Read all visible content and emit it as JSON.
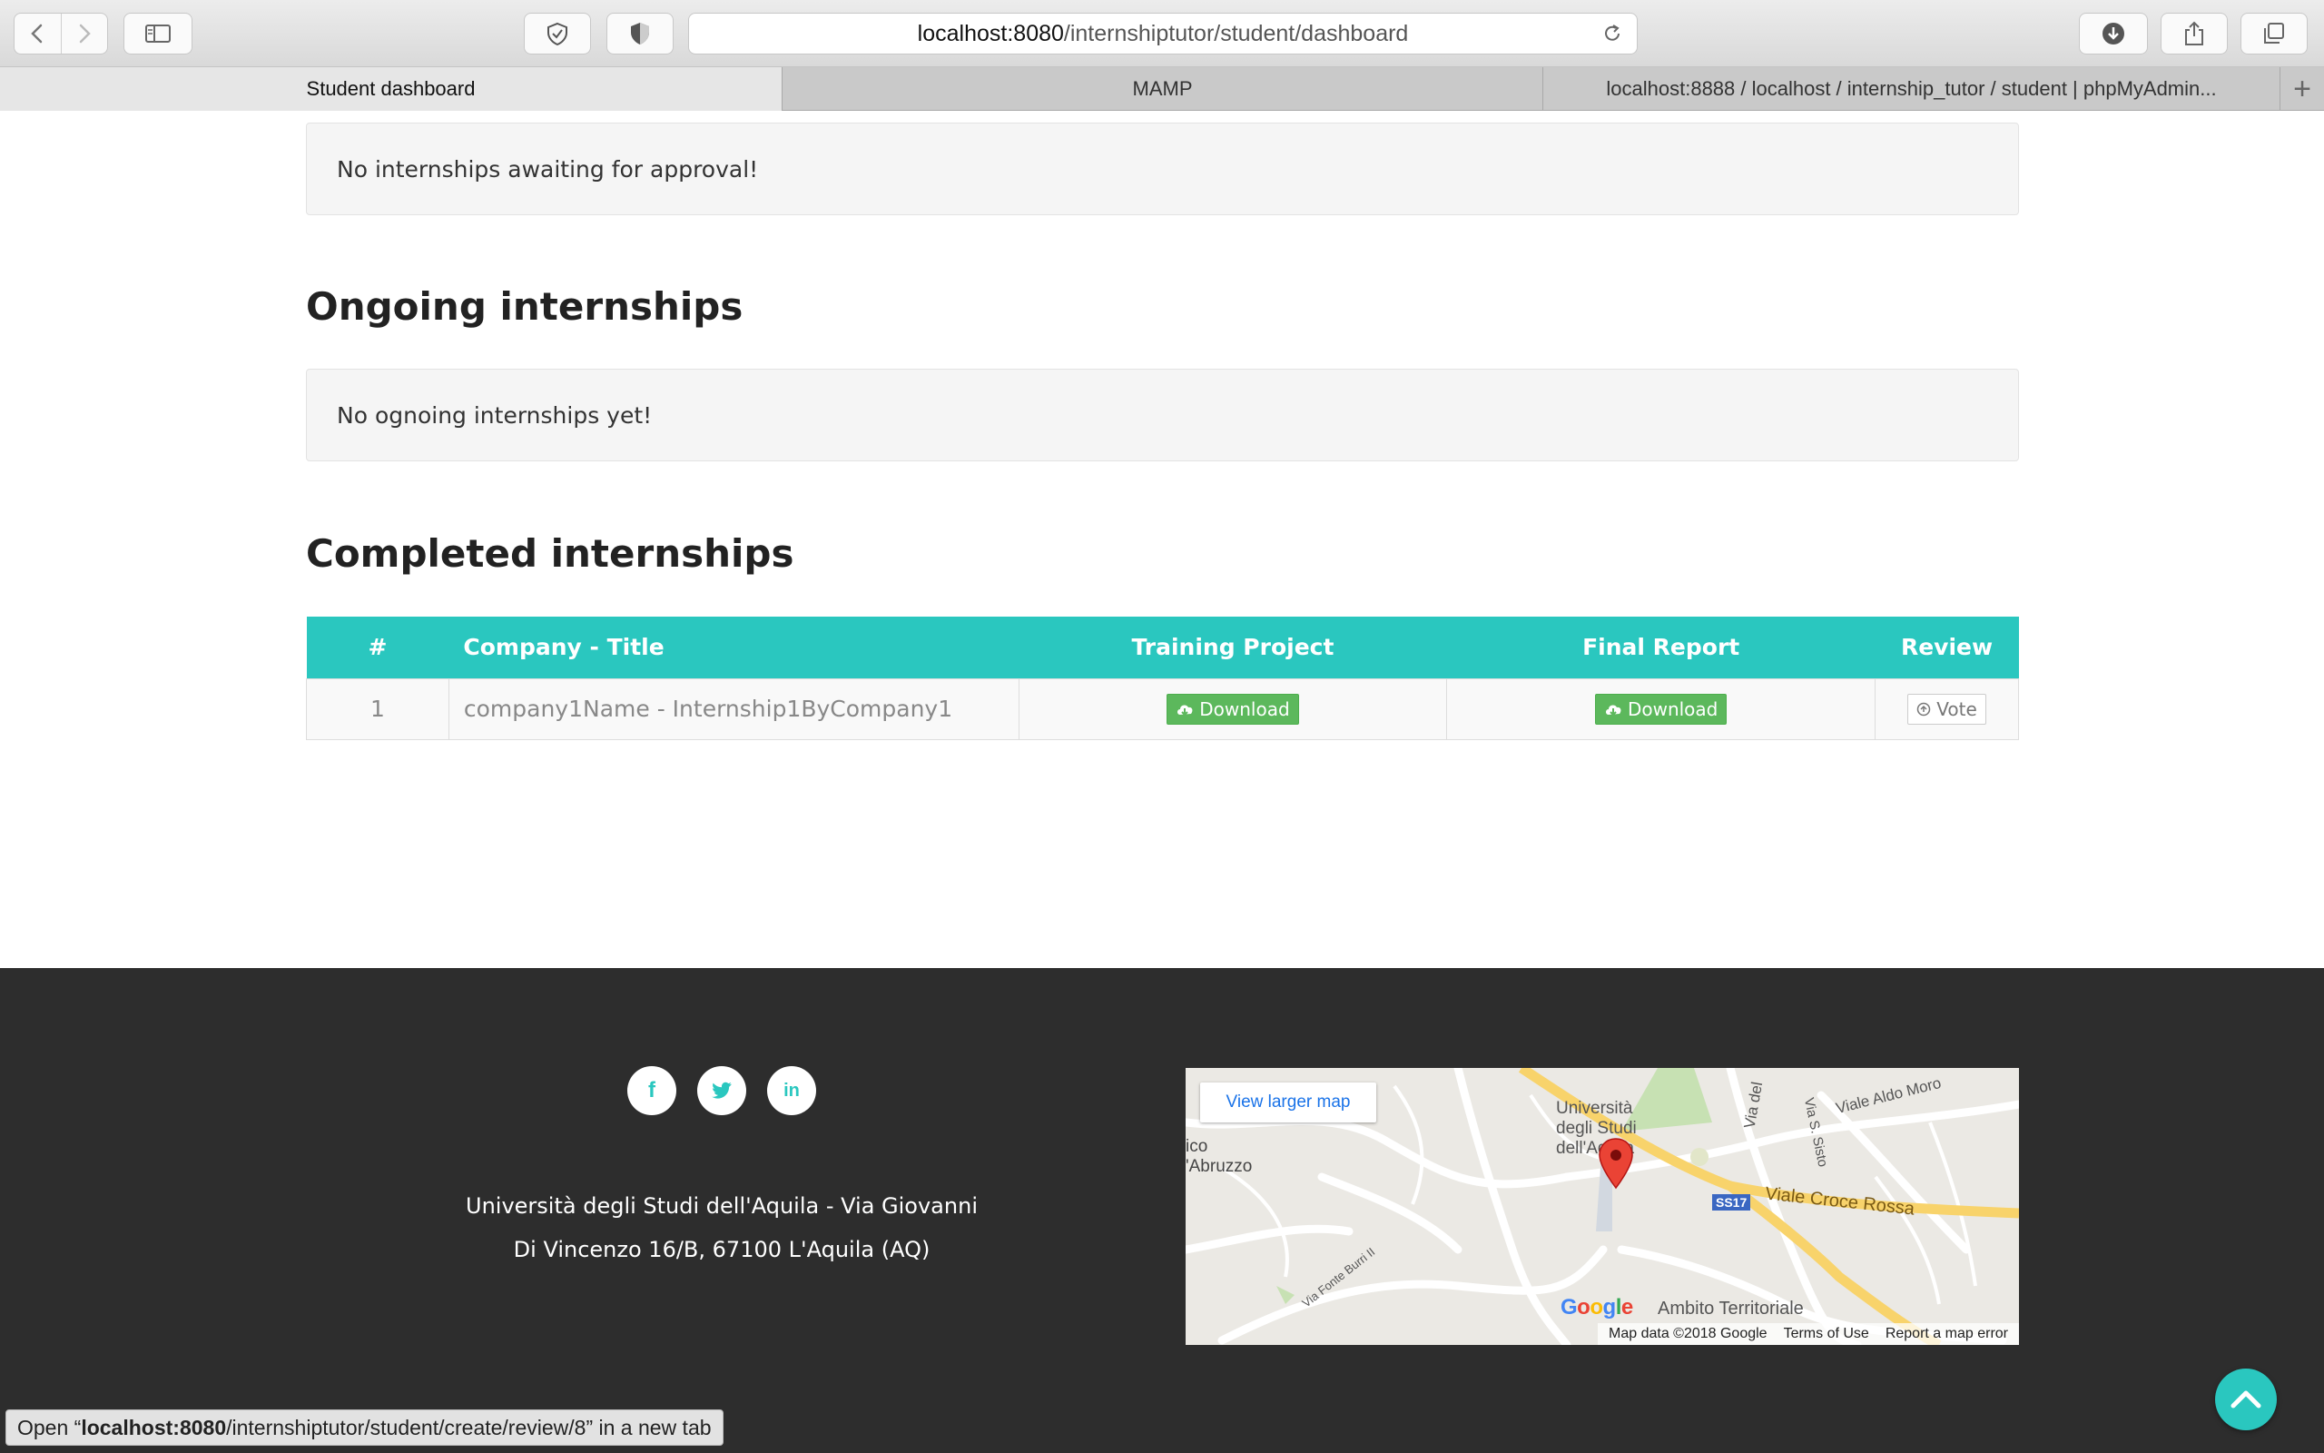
{
  "browser": {
    "url_host": "localhost:8080",
    "url_path": "/internshiptutor/student/dashboard",
    "tabs": [
      {
        "label": "Student dashboard"
      },
      {
        "label": "MAMP"
      },
      {
        "label": "localhost:8888 / localhost / internship_tutor / student | phpMyAdmin..."
      }
    ],
    "new_tab_label": "+",
    "status_prefix": "Open “",
    "status_host": "localhost:8080",
    "status_rest": "/internshiptutor/student/create/review/8” in a new tab"
  },
  "sections": {
    "awaiting_message": "No internships awaiting for approval!",
    "ongoing_title": "Ongoing internships",
    "ongoing_message": "No ognoing internships yet!",
    "completed_title": "Completed internships"
  },
  "completed_table": {
    "headers": [
      "#",
      "Company - Title",
      "Training Project",
      "Final Report",
      "Review"
    ],
    "rows": [
      {
        "num": "1",
        "company_title": "company1Name - Internship1ByCompany1",
        "training_project": "Download",
        "final_report": "Download",
        "review": "Vote"
      }
    ]
  },
  "footer": {
    "social": {
      "facebook": "f",
      "twitter": "t",
      "linkedin": "in"
    },
    "address_line1": "Università degli Studi dell'Aquila - Via Giovanni",
    "address_line2": "Di Vincenzo 16/B, 67100 L'Aquila (AQ)",
    "map": {
      "view_larger": "View larger map",
      "labels": {
        "university_1": "Università",
        "university_2": "degli Studi",
        "university_3": "dell'Aquila",
        "via_del": "Via del",
        "viale_aldo_moro": "Viale Aldo Moro",
        "via_s_sisto": "Via S. Sisto",
        "ss17": "SS17",
        "viale_croce_rossa": "Viale Croce Rossa",
        "abruzzo_1": "ico",
        "abruzzo_2": "'Abruzzo",
        "via_fonte_burri": "Via Fonte Burri II",
        "ambito": "Ambito Territoriale",
        "google": "Google"
      },
      "footer": {
        "map_data": "Map data ©2018 Google",
        "terms": "Terms of Use",
        "report": "Report a map error"
      }
    }
  },
  "colors": {
    "accent": "#2ac7bf",
    "success": "#5cb85c",
    "footer_bg": "#2d2d2d"
  }
}
